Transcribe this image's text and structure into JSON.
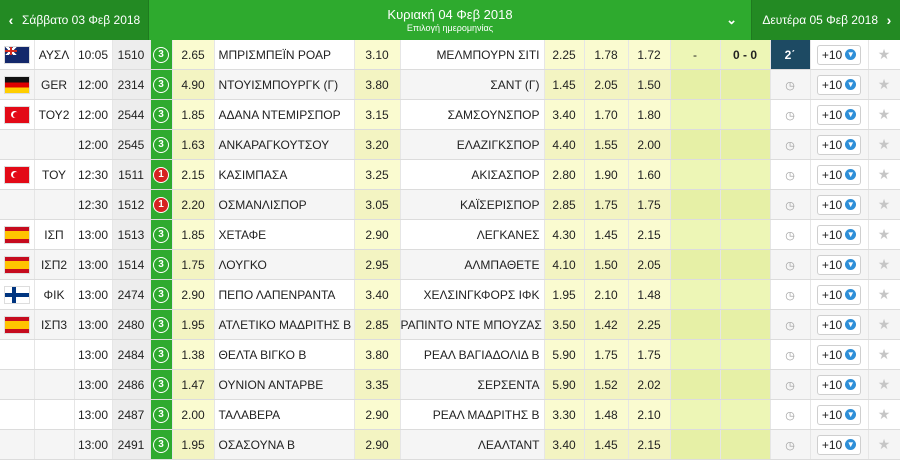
{
  "nav": {
    "prev_label": "Σάββατο 03 Φεβ 2018",
    "current_label": "Κυριακή 04 Φεβ 2018",
    "current_sub": "Επιλογή ημερομηνίας",
    "next_label": "Δευτέρα 05 Φεβ 2018",
    "prev_arrow": "‹",
    "next_arrow": "›",
    "chevron": "⌄"
  },
  "rows": [
    {
      "flag": "au",
      "league": "ΑΥΣΛ",
      "time": "10:05",
      "code": "1510",
      "status": "3",
      "status_color": "green",
      "o1": "2.65",
      "home": "ΜΠΡΙΣΜΠΕΪΝ ΡΟΑΡ",
      "ox": "3.10",
      "away": "ΜΕΛΜΠΟΥΡΝ ΣΙΤΙ",
      "o2": "2.25",
      "u": "1.78",
      "o": "1.72",
      "ht": "-",
      "score": "0 - 0",
      "live": "2΄",
      "plus": "+10",
      "star": "★"
    },
    {
      "flag": "de",
      "league": "GER",
      "time": "12:00",
      "code": "2314",
      "status": "3",
      "status_color": "green",
      "o1": "4.90",
      "home": "ΝΤΟΥΙΣΜΠΟΥΡΓΚ (Γ)",
      "ox": "3.80",
      "away": "ΣΑΝΤ (Γ)",
      "o2": "1.45",
      "u": "2.05",
      "o": "1.50",
      "ht": "",
      "score": "",
      "live": "",
      "plus": "+10",
      "star": "★"
    },
    {
      "flag": "tr",
      "league": "ΤΟΥ2",
      "time": "12:00",
      "code": "2544",
      "status": "3",
      "status_color": "green",
      "o1": "1.85",
      "home": "ΑΔΑΝΑ ΝΤΕΜΙΡΣΠΟΡ",
      "ox": "3.15",
      "away": "ΣΑΜΣΟΥΝΣΠΟΡ",
      "o2": "3.40",
      "u": "1.70",
      "o": "1.80",
      "ht": "",
      "score": "",
      "live": "",
      "plus": "+10",
      "star": "★"
    },
    {
      "flag": "",
      "league": "",
      "time": "12:00",
      "code": "2545",
      "status": "3",
      "status_color": "green",
      "o1": "1.63",
      "home": "ΑΝΚΑΡΑΓΚΟΥΤΣΟΥ",
      "ox": "3.20",
      "away": "ΕΛΑΖΙΓΚΣΠΟΡ",
      "o2": "4.40",
      "u": "1.55",
      "o": "2.00",
      "ht": "",
      "score": "",
      "live": "",
      "plus": "+10",
      "star": "★"
    },
    {
      "flag": "tr",
      "league": "ΤΟΥ",
      "time": "12:30",
      "code": "1511",
      "status": "1",
      "status_color": "red",
      "o1": "2.15",
      "home": "ΚΑΣΙΜΠΑΣΑ",
      "ox": "3.25",
      "away": "ΑΚΙΣΑΣΠΟΡ",
      "o2": "2.80",
      "u": "1.90",
      "o": "1.60",
      "ht": "",
      "score": "",
      "live": "",
      "plus": "+10",
      "star": "★"
    },
    {
      "flag": "",
      "league": "",
      "time": "12:30",
      "code": "1512",
      "status": "1",
      "status_color": "red",
      "o1": "2.20",
      "home": "ΟΣΜΑΝΛΙΣΠΟΡ",
      "ox": "3.05",
      "away": "ΚΑΪΣΕΡΙΣΠΟΡ",
      "o2": "2.85",
      "u": "1.75",
      "o": "1.75",
      "ht": "",
      "score": "",
      "live": "",
      "plus": "+10",
      "star": "★"
    },
    {
      "flag": "es",
      "league": "ΙΣΠ",
      "time": "13:00",
      "code": "1513",
      "status": "3",
      "status_color": "green",
      "o1": "1.85",
      "home": "ΧΕΤΑΦΕ",
      "ox": "2.90",
      "away": "ΛΕΓΚΑΝΕΣ",
      "o2": "4.30",
      "u": "1.45",
      "o": "2.15",
      "ht": "",
      "score": "",
      "live": "",
      "plus": "+10",
      "star": "★"
    },
    {
      "flag": "es",
      "league": "ΙΣΠ2",
      "time": "13:00",
      "code": "1514",
      "status": "3",
      "status_color": "green",
      "o1": "1.75",
      "home": "ΛΟΥΓΚΟ",
      "ox": "2.95",
      "away": "ΑΛΜΠΑΘΕΤΕ",
      "o2": "4.10",
      "u": "1.50",
      "o": "2.05",
      "ht": "",
      "score": "",
      "live": "",
      "plus": "+10",
      "star": "★"
    },
    {
      "flag": "fi",
      "league": "ΦΙΚ",
      "time": "13:00",
      "code": "2474",
      "status": "3",
      "status_color": "green",
      "o1": "2.90",
      "home": "ΠΕΠΟ ΛΑΠΕΝΡΑΝΤΑ",
      "ox": "3.40",
      "away": "ΧΕΛΣΙΝΓΚΦΟΡΣ ΙΦΚ",
      "o2": "1.95",
      "u": "2.10",
      "o": "1.48",
      "ht": "",
      "score": "",
      "live": "",
      "plus": "+10",
      "star": "★"
    },
    {
      "flag": "es",
      "league": "ΙΣΠ3",
      "time": "13:00",
      "code": "2480",
      "status": "3",
      "status_color": "green",
      "o1": "1.95",
      "home": "ΑΤΛΕΤΙΚΟ ΜΑΔΡΙΤΗΣ Β",
      "ox": "2.85",
      "away": "ΡΑΠΙΝΤΟ ΝΤΕ ΜΠΟΥΖΑΣ",
      "o2": "3.50",
      "u": "1.42",
      "o": "2.25",
      "ht": "",
      "score": "",
      "live": "",
      "plus": "+10",
      "star": "★"
    },
    {
      "flag": "",
      "league": "",
      "time": "13:00",
      "code": "2484",
      "status": "3",
      "status_color": "green",
      "o1": "1.38",
      "home": "ΘΕΛΤΑ ΒΙΓΚΟ Β",
      "ox": "3.80",
      "away": "ΡΕΑΛ ΒΑΓΙΑΔΟΛΙΔ Β",
      "o2": "5.90",
      "u": "1.75",
      "o": "1.75",
      "ht": "",
      "score": "",
      "live": "",
      "plus": "+10",
      "star": "★"
    },
    {
      "flag": "",
      "league": "",
      "time": "13:00",
      "code": "2486",
      "status": "3",
      "status_color": "green",
      "o1": "1.47",
      "home": "ΟΥΝΙΟΝ ΑΝΤΑΡΒΕ",
      "ox": "3.35",
      "away": "ΣΕΡΣΕΝΤΑ",
      "o2": "5.90",
      "u": "1.52",
      "o": "2.02",
      "ht": "",
      "score": "",
      "live": "",
      "plus": "+10",
      "star": "★"
    },
    {
      "flag": "",
      "league": "",
      "time": "13:00",
      "code": "2487",
      "status": "3",
      "status_color": "green",
      "o1": "2.00",
      "home": "ΤΑΛΑΒΕΡΑ",
      "ox": "2.90",
      "away": "ΡΕΑΛ ΜΑΔΡΙΤΗΣ Β",
      "o2": "3.30",
      "u": "1.48",
      "o": "2.10",
      "ht": "",
      "score": "",
      "live": "",
      "plus": "+10",
      "star": "★"
    },
    {
      "flag": "",
      "league": "",
      "time": "13:00",
      "code": "2491",
      "status": "3",
      "status_color": "green",
      "o1": "1.95",
      "home": "ΟΣΑΣΟΥΝΑ Β",
      "ox": "2.90",
      "away": "ΛΕΑΛΤΑΝΤ",
      "o2": "3.40",
      "u": "1.45",
      "o": "2.15",
      "ht": "",
      "score": "",
      "live": "",
      "plus": "+10",
      "star": "★"
    }
  ],
  "icons": {
    "clock": "clock-icon",
    "star": "star-icon",
    "down": "arrow-down-circle-icon"
  },
  "colors": {
    "brand_green": "#2eaa2e",
    "dark_green": "#238a23",
    "live_blue": "#1d4a63",
    "status_red": "#d52222",
    "odds_yellow": "#fafbd0"
  }
}
